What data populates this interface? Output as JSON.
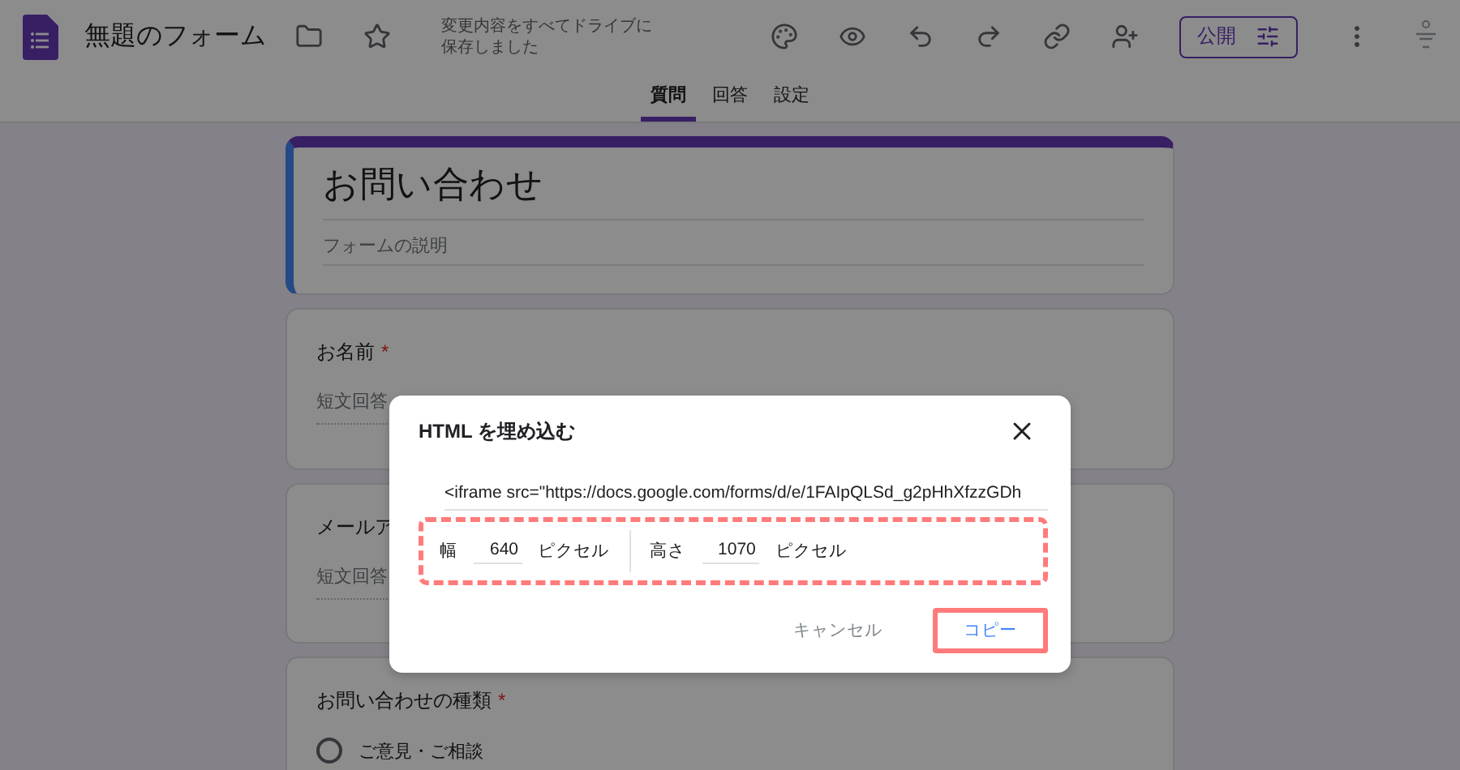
{
  "app": {
    "title": "無題のフォーム",
    "save_status": "変更内容をすべてドライブに保存しました",
    "publish_button": "公開"
  },
  "tabs": [
    {
      "label": "質問",
      "selected": true
    },
    {
      "label": "回答",
      "selected": false
    },
    {
      "label": "設定",
      "selected": false
    }
  ],
  "form": {
    "title": "お問い合わせ",
    "description_placeholder": "フォームの説明",
    "required_mark": "*",
    "questions": [
      {
        "kind": "short",
        "title": "お名前",
        "required": true,
        "answer_placeholder": "短文回答"
      },
      {
        "kind": "short",
        "title": "メールア",
        "answer_placeholder": "短文回答"
      },
      {
        "kind": "radio",
        "title": "お問い合わせの種類",
        "required": true,
        "options": [
          {
            "label": "ご意見・ご相談",
            "selected": false
          }
        ]
      }
    ]
  },
  "dialog": {
    "title": "HTML を埋め込む",
    "code": "<iframe src=\"https://docs.google.com/forms/d/e/1FAIpQLSd_g2pHhXfzzGDh",
    "width_label": "幅",
    "width_value": "640",
    "width_unit": "ピクセル",
    "height_label": "高さ",
    "height_value": "1070",
    "height_unit": "ピクセル",
    "buttons": [
      {
        "label": "キャンセル",
        "kind": "cancel"
      },
      {
        "label": "コピー",
        "kind": "primary"
      }
    ]
  }
}
